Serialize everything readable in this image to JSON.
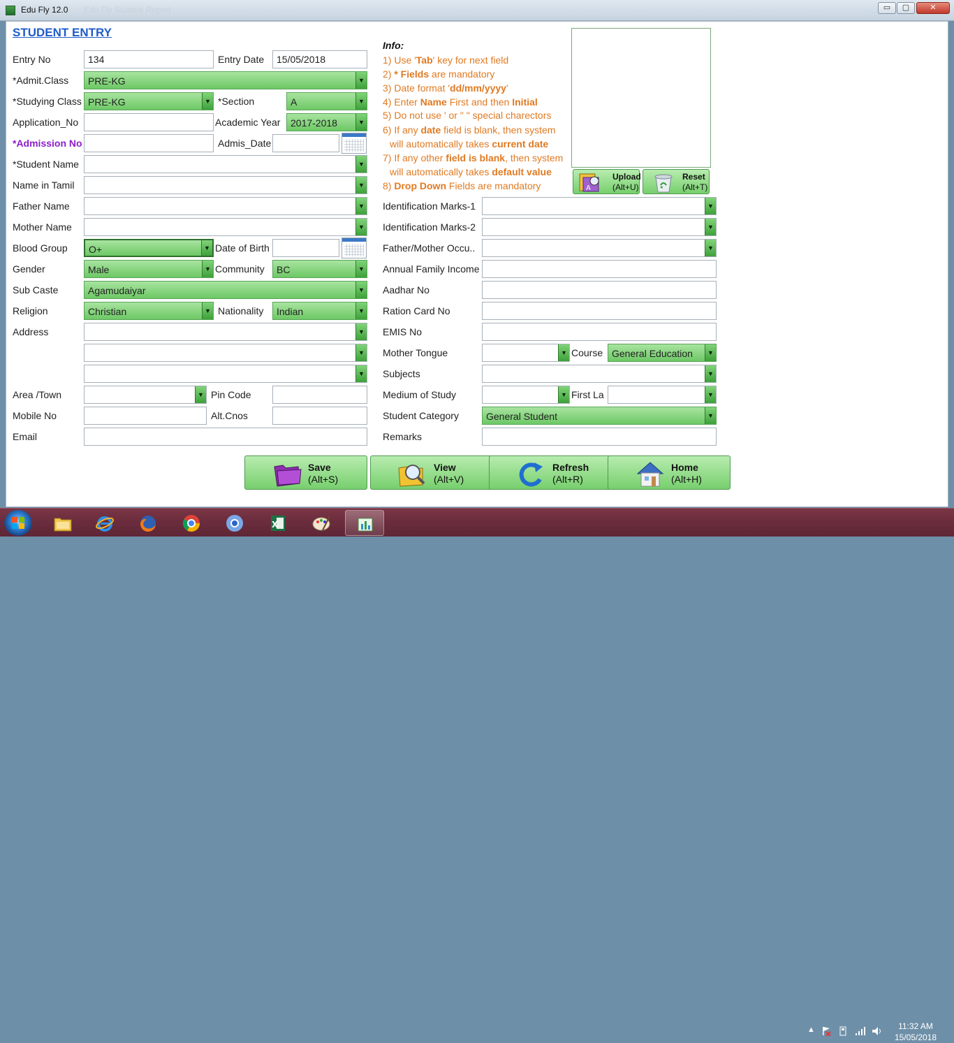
{
  "window": {
    "title": "Edu Fly 12.0",
    "ghost_title": "Edu Fly Student Report",
    "min_label": "▭",
    "max_label": "▢",
    "close_label": "✕"
  },
  "form": {
    "heading": "STUDENT ENTRY",
    "entry_no": {
      "label": "Entry No",
      "value": "134"
    },
    "entry_date": {
      "label": "Entry Date",
      "value": "15/05/2018"
    },
    "admit_class": {
      "label": "*Admit.Class",
      "value": "PRE-KG"
    },
    "studying_class": {
      "label": "*Studying Class",
      "value": "PRE-KG"
    },
    "section": {
      "label": "*Section",
      "value": "A"
    },
    "application_no": {
      "label": "Application_No",
      "value": ""
    },
    "academic_year": {
      "label": "Academic Year",
      "value": "2017-2018"
    },
    "admission_no": {
      "label": "*Admission No",
      "value": ""
    },
    "admis_date": {
      "label": "Admis_Date",
      "value": ""
    },
    "student_name": {
      "label": "*Student Name",
      "value": ""
    },
    "name_in_tamil": {
      "label": "Name in Tamil",
      "value": ""
    },
    "father_name": {
      "label": "Father Name",
      "value": ""
    },
    "mother_name": {
      "label": "Mother Name",
      "value": ""
    },
    "blood_group": {
      "label": "Blood Group",
      "value": "O+"
    },
    "date_of_birth": {
      "label": "Date of Birth",
      "value": ""
    },
    "gender": {
      "label": "Gender",
      "value": "Male"
    },
    "community": {
      "label": "Community",
      "value": "BC"
    },
    "sub_caste": {
      "label": "Sub Caste",
      "value": "Agamudaiyar"
    },
    "religion": {
      "label": "Religion",
      "value": "Christian"
    },
    "nationality": {
      "label": "Nationality",
      "value": "Indian"
    },
    "address": {
      "label": "Address",
      "line1": "",
      "line2": "",
      "line3": ""
    },
    "area_town": {
      "label": "Area /Town",
      "value": ""
    },
    "pin_code": {
      "label": "Pin Code",
      "value": ""
    },
    "mobile_no": {
      "label": "Mobile No",
      "value": ""
    },
    "alt_cnos": {
      "label": "Alt.Cnos",
      "value": ""
    },
    "email": {
      "label": "Email",
      "value": ""
    },
    "identification_marks_1": {
      "label": "Identification Marks-1",
      "value": ""
    },
    "identification_marks_2": {
      "label": "Identification Marks-2",
      "value": ""
    },
    "father_mother_occupation": {
      "label": "Father/Mother Occu..",
      "value": ""
    },
    "annual_family_income": {
      "label": "Annual Family Income",
      "value": ""
    },
    "aadhar_no": {
      "label": "Aadhar No",
      "value": ""
    },
    "ration_card_no": {
      "label": "Ration Card No",
      "value": ""
    },
    "emis_no": {
      "label": "EMIS No",
      "value": ""
    },
    "mother_tongue": {
      "label": "Mother Tongue",
      "value": ""
    },
    "course": {
      "label": "Course",
      "value": "General Education"
    },
    "subjects": {
      "label": "Subjects",
      "value": ""
    },
    "medium_of_study": {
      "label": "Medium of Study",
      "value": ""
    },
    "first_language": {
      "label": "First La",
      "value": ""
    },
    "student_category": {
      "label": "Student Category",
      "value": "General Student"
    },
    "remarks": {
      "label": "Remarks",
      "value": ""
    }
  },
  "info": {
    "title": "Info:",
    "l1a": "1) Use '",
    "l1b": "Tab",
    "l1c": "' key for next field",
    "l2a": "2) ",
    "l2b": "* Fields",
    "l2c": " are mandatory",
    "l3a": "3) Date format '",
    "l3b": "dd/mm/yyyy",
    "l3c": "'",
    "l4a": "4) Enter ",
    "l4b": "Name",
    "l4c": " First and then ",
    "l4d": "Initial",
    "l5": "5) Do not use ' or \" \" special charectors",
    "l6a": "6) If any ",
    "l6b": "date",
    "l6c": " field is blank, then system",
    "l6d": "will automatically takes ",
    "l6e": "current date",
    "l7a": "7) If any other ",
    "l7b": "field is blank",
    "l7c": ", then system",
    "l7d": "will automatically takes ",
    "l7e": "default value",
    "l8a": "8) ",
    "l8b": "Drop Down",
    "l8c": " Fields are mandatory"
  },
  "photo_buttons": {
    "upload": {
      "label": "Upload",
      "shortcut": "(Alt+U)"
    },
    "reset": {
      "label": "Reset",
      "shortcut": "(Alt+T)"
    }
  },
  "actions": {
    "save": {
      "label": "Save",
      "shortcut": "(Alt+S)"
    },
    "view": {
      "label": "View",
      "shortcut": "(Alt+V)"
    },
    "refresh": {
      "label": "Refresh",
      "shortcut": "(Alt+R)"
    },
    "home": {
      "label": "Home",
      "shortcut": "(Alt+H)"
    }
  },
  "taskbar": {
    "items": [
      "file-explorer",
      "internet-explorer",
      "firefox",
      "chrome",
      "chromium",
      "excel",
      "paint",
      "edu-fly"
    ],
    "active_item": "edu-fly",
    "time": "11:32 AM",
    "date": "15/05/2018"
  },
  "colors": {
    "accent": "#1f5cc9",
    "mandatory": "#8d1fc9",
    "info_text": "#e07a22",
    "dropdown_fill": "#77cf6d",
    "taskbar": "#6b2d3d"
  }
}
